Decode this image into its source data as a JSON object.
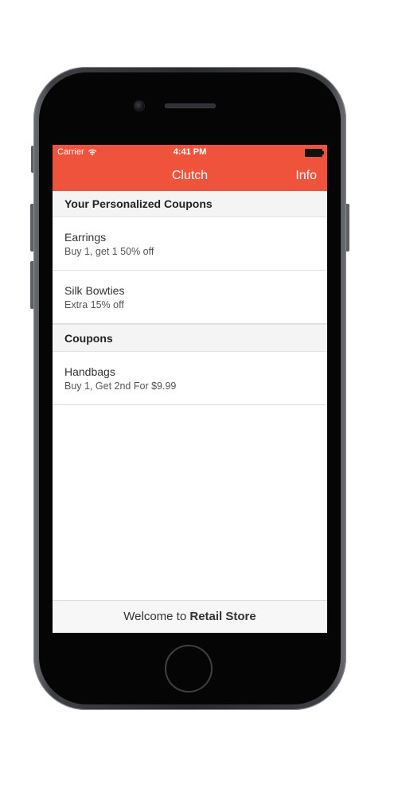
{
  "status_bar": {
    "carrier": "Carrier",
    "time": "4:41 PM"
  },
  "navbar": {
    "title": "Clutch",
    "info_label": "Info",
    "background_color": "#f0533c"
  },
  "sections": [
    {
      "title": "Your Personalized Coupons",
      "items": [
        {
          "title": "Earrings",
          "subtitle": "Buy 1, get 1 50% off"
        },
        {
          "title": "Silk Bowties",
          "subtitle": "Extra 15% off"
        }
      ]
    },
    {
      "title": "Coupons",
      "items": [
        {
          "title": "Handbags",
          "subtitle": "Buy 1, Get 2nd For $9.99"
        }
      ]
    }
  ],
  "footer": {
    "prefix": "Welcome to ",
    "store_name": "Retail Store"
  },
  "icons": {
    "wifi": "wifi-icon",
    "battery": "battery-icon"
  }
}
